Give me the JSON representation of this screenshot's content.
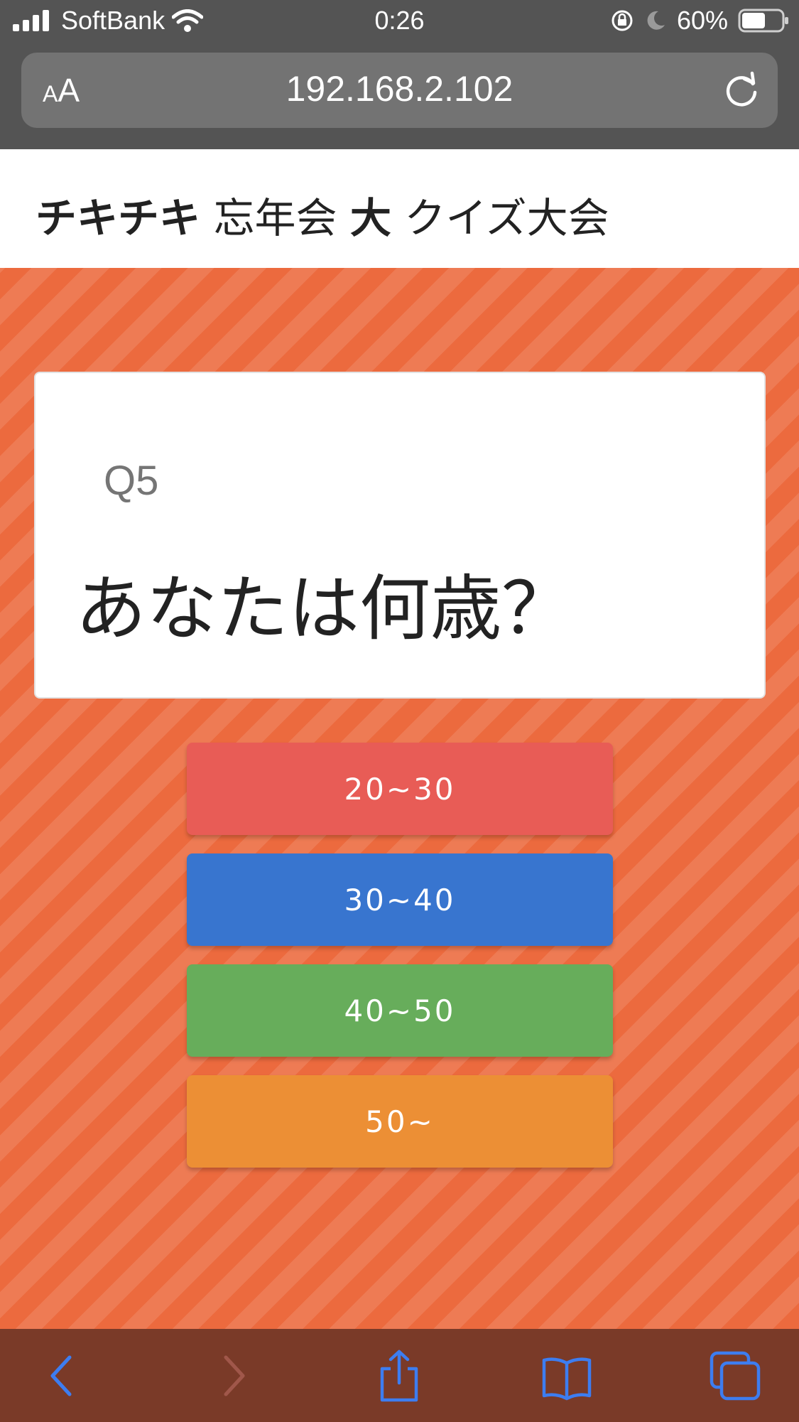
{
  "status_bar": {
    "carrier": "SoftBank",
    "time": "0:26",
    "battery_percent": "60%",
    "battery_level": 0.6
  },
  "browser": {
    "text_size_label_small": "A",
    "text_size_label_large": "A",
    "url": "192.168.2.102"
  },
  "page": {
    "title_part1": "チキチキ",
    "title_part2": " 忘年会 ",
    "title_part3": "大",
    "title_part4": " クイズ大会"
  },
  "question": {
    "number": "Q5",
    "text": "あなたは何歳？"
  },
  "answers": [
    {
      "label": "20~30",
      "color": "#e85c56"
    },
    {
      "label": "30~40",
      "color": "#3875cf"
    },
    {
      "label": "40~50",
      "color": "#67ad5b"
    },
    {
      "label": "50~",
      "color": "#ec8f35"
    }
  ],
  "toolbar": {
    "icons": [
      "back-icon",
      "forward-icon",
      "share-icon",
      "bookmarks-icon",
      "tabs-icon"
    ],
    "icon_color": "#3d7df0"
  }
}
